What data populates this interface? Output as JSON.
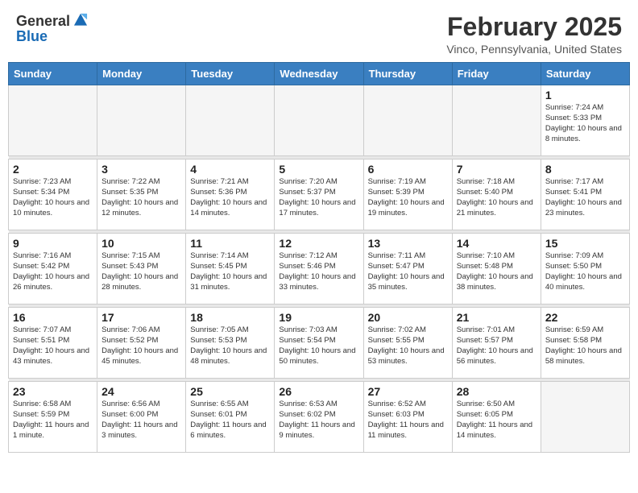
{
  "header": {
    "logo_general": "General",
    "logo_blue": "Blue",
    "main_title": "February 2025",
    "subtitle": "Vinco, Pennsylvania, United States"
  },
  "calendar": {
    "days_of_week": [
      "Sunday",
      "Monday",
      "Tuesday",
      "Wednesday",
      "Thursday",
      "Friday",
      "Saturday"
    ],
    "weeks": [
      [
        {
          "day": "",
          "info": "",
          "empty": true
        },
        {
          "day": "",
          "info": "",
          "empty": true
        },
        {
          "day": "",
          "info": "",
          "empty": true
        },
        {
          "day": "",
          "info": "",
          "empty": true
        },
        {
          "day": "",
          "info": "",
          "empty": true
        },
        {
          "day": "",
          "info": "",
          "empty": true
        },
        {
          "day": "1",
          "info": "Sunrise: 7:24 AM\nSunset: 5:33 PM\nDaylight: 10 hours\nand 8 minutes.",
          "empty": false
        }
      ],
      [
        {
          "day": "2",
          "info": "Sunrise: 7:23 AM\nSunset: 5:34 PM\nDaylight: 10 hours\nand 10 minutes.",
          "empty": false
        },
        {
          "day": "3",
          "info": "Sunrise: 7:22 AM\nSunset: 5:35 PM\nDaylight: 10 hours\nand 12 minutes.",
          "empty": false
        },
        {
          "day": "4",
          "info": "Sunrise: 7:21 AM\nSunset: 5:36 PM\nDaylight: 10 hours\nand 14 minutes.",
          "empty": false
        },
        {
          "day": "5",
          "info": "Sunrise: 7:20 AM\nSunset: 5:37 PM\nDaylight: 10 hours\nand 17 minutes.",
          "empty": false
        },
        {
          "day": "6",
          "info": "Sunrise: 7:19 AM\nSunset: 5:39 PM\nDaylight: 10 hours\nand 19 minutes.",
          "empty": false
        },
        {
          "day": "7",
          "info": "Sunrise: 7:18 AM\nSunset: 5:40 PM\nDaylight: 10 hours\nand 21 minutes.",
          "empty": false
        },
        {
          "day": "8",
          "info": "Sunrise: 7:17 AM\nSunset: 5:41 PM\nDaylight: 10 hours\nand 23 minutes.",
          "empty": false
        }
      ],
      [
        {
          "day": "9",
          "info": "Sunrise: 7:16 AM\nSunset: 5:42 PM\nDaylight: 10 hours\nand 26 minutes.",
          "empty": false
        },
        {
          "day": "10",
          "info": "Sunrise: 7:15 AM\nSunset: 5:43 PM\nDaylight: 10 hours\nand 28 minutes.",
          "empty": false
        },
        {
          "day": "11",
          "info": "Sunrise: 7:14 AM\nSunset: 5:45 PM\nDaylight: 10 hours\nand 31 minutes.",
          "empty": false
        },
        {
          "day": "12",
          "info": "Sunrise: 7:12 AM\nSunset: 5:46 PM\nDaylight: 10 hours\nand 33 minutes.",
          "empty": false
        },
        {
          "day": "13",
          "info": "Sunrise: 7:11 AM\nSunset: 5:47 PM\nDaylight: 10 hours\nand 35 minutes.",
          "empty": false
        },
        {
          "day": "14",
          "info": "Sunrise: 7:10 AM\nSunset: 5:48 PM\nDaylight: 10 hours\nand 38 minutes.",
          "empty": false
        },
        {
          "day": "15",
          "info": "Sunrise: 7:09 AM\nSunset: 5:50 PM\nDaylight: 10 hours\nand 40 minutes.",
          "empty": false
        }
      ],
      [
        {
          "day": "16",
          "info": "Sunrise: 7:07 AM\nSunset: 5:51 PM\nDaylight: 10 hours\nand 43 minutes.",
          "empty": false
        },
        {
          "day": "17",
          "info": "Sunrise: 7:06 AM\nSunset: 5:52 PM\nDaylight: 10 hours\nand 45 minutes.",
          "empty": false
        },
        {
          "day": "18",
          "info": "Sunrise: 7:05 AM\nSunset: 5:53 PM\nDaylight: 10 hours\nand 48 minutes.",
          "empty": false
        },
        {
          "day": "19",
          "info": "Sunrise: 7:03 AM\nSunset: 5:54 PM\nDaylight: 10 hours\nand 50 minutes.",
          "empty": false
        },
        {
          "day": "20",
          "info": "Sunrise: 7:02 AM\nSunset: 5:55 PM\nDaylight: 10 hours\nand 53 minutes.",
          "empty": false
        },
        {
          "day": "21",
          "info": "Sunrise: 7:01 AM\nSunset: 5:57 PM\nDaylight: 10 hours\nand 56 minutes.",
          "empty": false
        },
        {
          "day": "22",
          "info": "Sunrise: 6:59 AM\nSunset: 5:58 PM\nDaylight: 10 hours\nand 58 minutes.",
          "empty": false
        }
      ],
      [
        {
          "day": "23",
          "info": "Sunrise: 6:58 AM\nSunset: 5:59 PM\nDaylight: 11 hours\nand 1 minute.",
          "empty": false
        },
        {
          "day": "24",
          "info": "Sunrise: 6:56 AM\nSunset: 6:00 PM\nDaylight: 11 hours\nand 3 minutes.",
          "empty": false
        },
        {
          "day": "25",
          "info": "Sunrise: 6:55 AM\nSunset: 6:01 PM\nDaylight: 11 hours\nand 6 minutes.",
          "empty": false
        },
        {
          "day": "26",
          "info": "Sunrise: 6:53 AM\nSunset: 6:02 PM\nDaylight: 11 hours\nand 9 minutes.",
          "empty": false
        },
        {
          "day": "27",
          "info": "Sunrise: 6:52 AM\nSunset: 6:03 PM\nDaylight: 11 hours\nand 11 minutes.",
          "empty": false
        },
        {
          "day": "28",
          "info": "Sunrise: 6:50 AM\nSunset: 6:05 PM\nDaylight: 11 hours\nand 14 minutes.",
          "empty": false
        },
        {
          "day": "",
          "info": "",
          "empty": true
        }
      ]
    ]
  }
}
